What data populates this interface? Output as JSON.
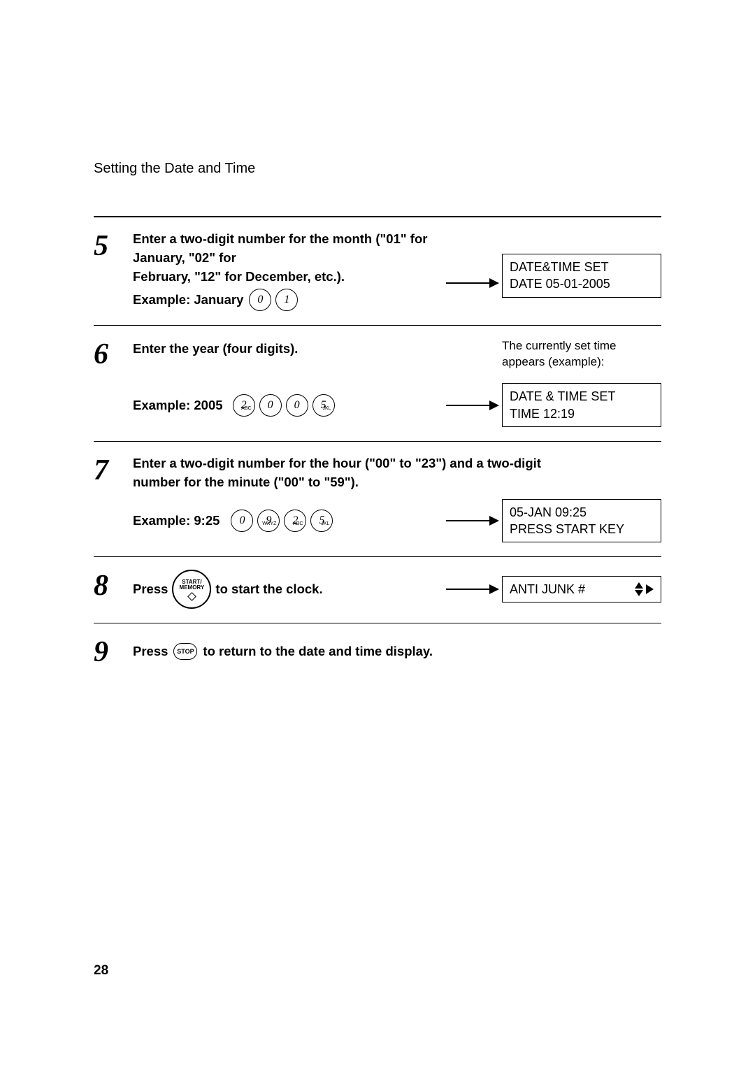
{
  "header": "Setting the Date and Time",
  "page_number": "28",
  "steps": {
    "s5": {
      "num": "5",
      "line1": "Enter a two-digit number for the month (\"01\" for January, \"02\" for",
      "line2": "February, \"12\" for December, etc.).",
      "example_label": "Example: January",
      "keys": [
        "0",
        "1"
      ],
      "display_l1": "DATE&TIME SET",
      "display_l2": "DATE 05-01-2005"
    },
    "s6": {
      "num": "6",
      "instr": "Enter the year (four digits).",
      "note_l1": "The currently set time",
      "note_l2": "appears (example):",
      "example_label": "Example: 2005",
      "keys": [
        {
          "d": "2",
          "s": "ABC"
        },
        {
          "d": "0",
          "s": ""
        },
        {
          "d": "0",
          "s": ""
        },
        {
          "d": "5",
          "s": "JKL"
        }
      ],
      "display_l1": "DATE & TIME SET",
      "display_l2": "TIME 12:19"
    },
    "s7": {
      "num": "7",
      "line1": "Enter a two-digit number for the hour (\"00\" to \"23\") and a two-digit",
      "line2": "number for the minute (\"00\" to \"59\").",
      "example_label": "Example: 9:25",
      "keys": [
        {
          "d": "0",
          "s": ""
        },
        {
          "d": "9",
          "s": "WXYZ"
        },
        {
          "d": "2",
          "s": "ABC"
        },
        {
          "d": "5",
          "s": "JKL"
        }
      ],
      "display_l1": "05-JAN 09:25",
      "display_l2": "PRESS START KEY"
    },
    "s8": {
      "num": "8",
      "press": "Press",
      "key_l1": "START/",
      "key_l2": "MEMORY",
      "rest": " to start the clock.",
      "display": "ANTI JUNK #"
    },
    "s9": {
      "num": "9",
      "press": "Press ",
      "stop": "STOP",
      "rest": " to return to the date and time display."
    }
  }
}
